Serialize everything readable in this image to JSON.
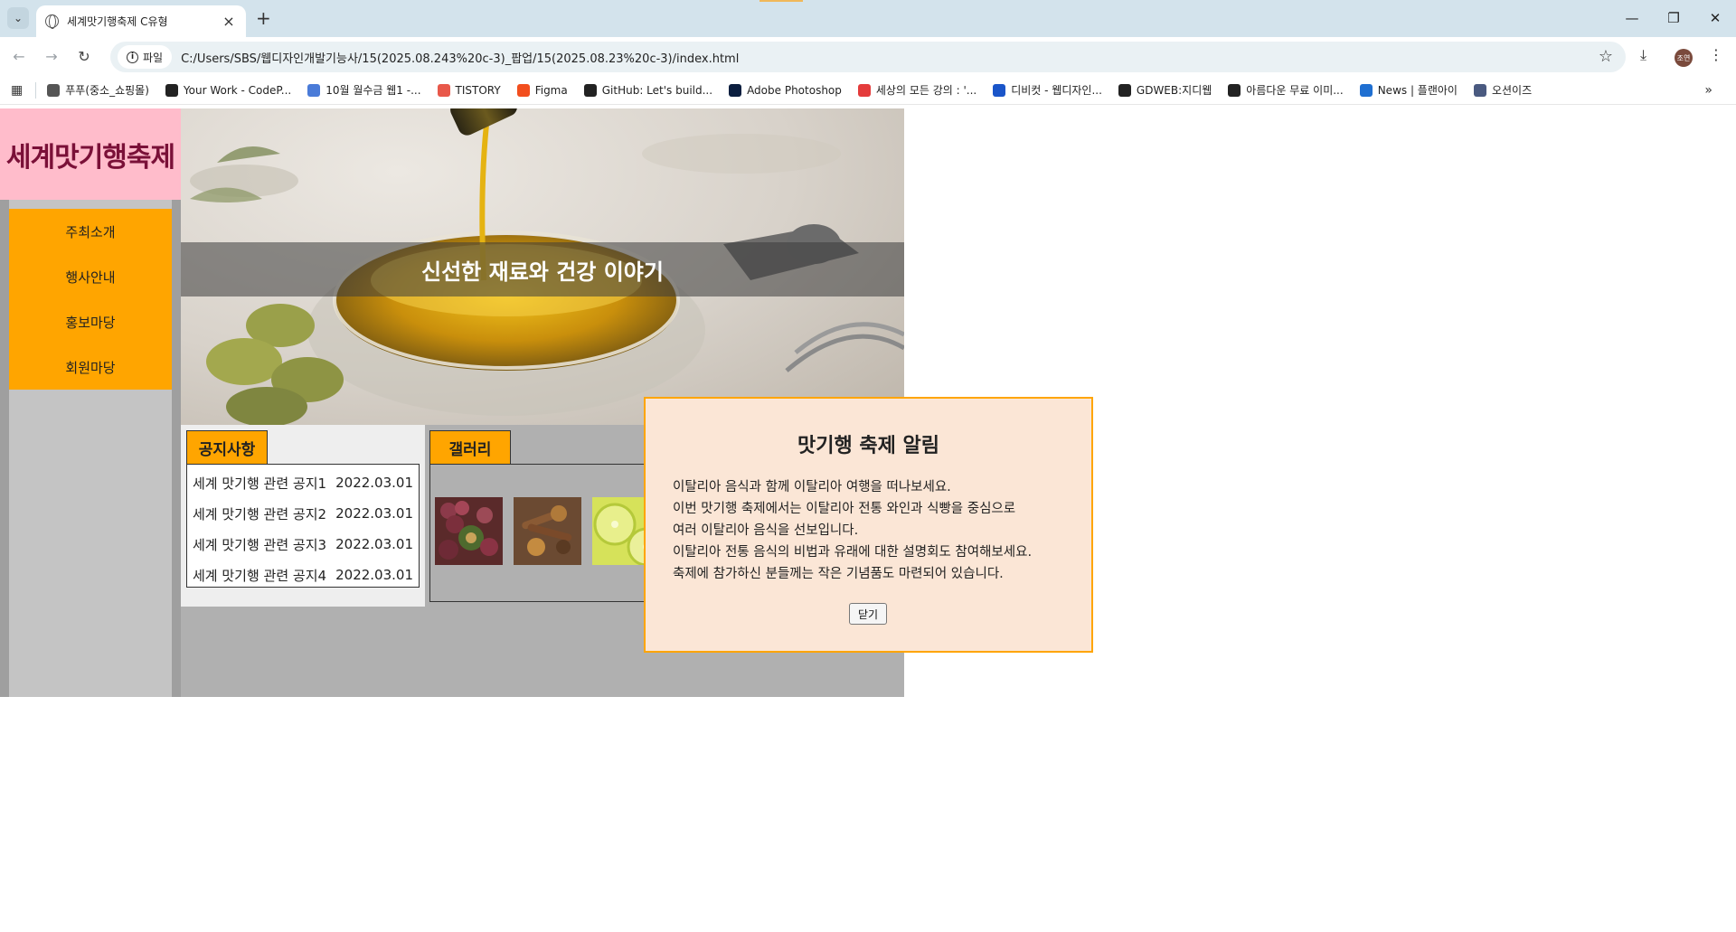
{
  "browser": {
    "tab_title": "세계맛기행축제 C유형",
    "file_chip": "파일",
    "url": "C:/Users/SBS/웹디자인개발기능사/15(2025.08.243%20c-3)_팝업/15(2025.08.23%20c-3)/index.html",
    "profile_initials": "조연",
    "bookmarks": [
      {
        "label": "푸푸(중소_쇼핑몰)",
        "icon": "folder-icon",
        "color": "#555555"
      },
      {
        "label": "Your Work - CodeP...",
        "icon": "codepen-icon",
        "color": "#222222"
      },
      {
        "label": "10월 월수금 웹1 -...",
        "icon": "docs-icon",
        "color": "#4a7bd8"
      },
      {
        "label": "TISTORY",
        "icon": "tistory-icon",
        "color": "#e8584a"
      },
      {
        "label": "Figma",
        "icon": "figma-icon",
        "color": "#f24e1e"
      },
      {
        "label": "GitHub: Let's build...",
        "icon": "github-icon",
        "color": "#222222"
      },
      {
        "label": "Adobe Photoshop",
        "icon": "photoshop-icon",
        "color": "#0b1e3f"
      },
      {
        "label": "세상의 모든 강의 : '...",
        "icon": "play-icon",
        "color": "#e43b3b"
      },
      {
        "label": "디비컷 - 웹디자인...",
        "icon": "dbcut-icon",
        "color": "#1a55c9"
      },
      {
        "label": "GDWEB:지디웹",
        "icon": "gdweb-icon",
        "color": "#222222"
      },
      {
        "label": "아름다운 무료 이미...",
        "icon": "unsplash-icon",
        "color": "#222222"
      },
      {
        "label": "News | 플랜아이",
        "icon": "info-icon",
        "color": "#1f6fd1"
      },
      {
        "label": "오션이즈",
        "icon": "oceanis-icon",
        "color": "#4a5a80"
      }
    ]
  },
  "site": {
    "logo": "세계맛기행축제",
    "menu": [
      "주최소개",
      "행사안내",
      "홍보마당",
      "회원마당"
    ],
    "hero_title": "신선한 재료와 건강 이야기",
    "notice": {
      "tab": "공지사항",
      "items": [
        {
          "title": "세계 맛기행 관련 공지1",
          "date": "2022.03.01"
        },
        {
          "title": "세계 맛기행 관련 공지2",
          "date": "2022.03.01"
        },
        {
          "title": "세계 맛기행 관련 공지3",
          "date": "2022.03.01"
        },
        {
          "title": "세계 맛기행 관련 공지4",
          "date": "2022.03.01"
        }
      ]
    },
    "gallery": {
      "tab": "갤러리"
    }
  },
  "modal": {
    "title": "맛기행 축제 알림",
    "lines": [
      "이탈리아 음식과 함께 이탈리아 여행을 떠나보세요.",
      "이번 맛기행 축제에서는 이탈리아 전통 와인과 식빵을 중심으로",
      "여러 이탈리아 음식을 선보입니다.",
      "이탈리아 전통 음식의 비법과 유래에 대한 설명회도 참여해보세요.",
      "축제에 참가하신 분들께는 작은 기념품도 마련되어 있습니다."
    ],
    "close_label": "닫기"
  },
  "colors": {
    "accent_orange": "#ffa500",
    "logo_bg": "#ffbccb",
    "logo_text": "#7a1038",
    "modal_bg": "#fbe6d6"
  }
}
